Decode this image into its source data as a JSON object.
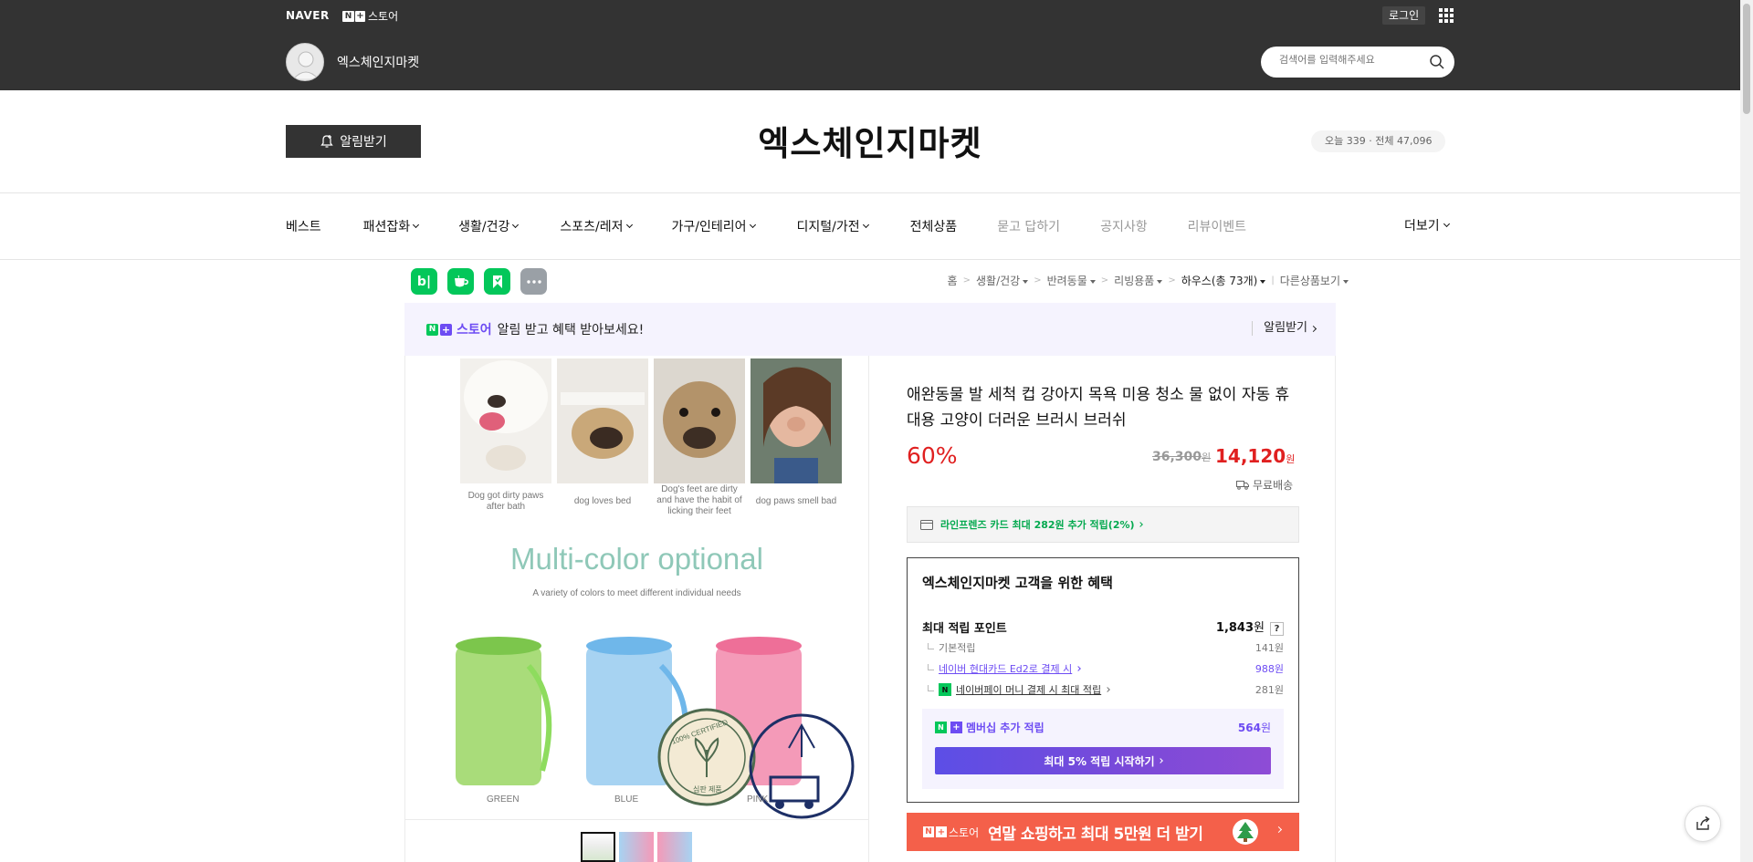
{
  "topbar": {
    "naver_logo": "NAVER",
    "store_brand": "스토어",
    "login_label": "로그인",
    "store_name": "엑스체인지마켓",
    "search_placeholder": "검색어를 입력해주세요"
  },
  "header": {
    "alarm_label": "알림받기",
    "store_title": "엑스체인지마켓",
    "visitors_today": "오늘 339",
    "visitors_total": "전체 47,096"
  },
  "nav": {
    "items": [
      {
        "label": "베스트",
        "dropdown": false
      },
      {
        "label": "패션잡화",
        "dropdown": true
      },
      {
        "label": "생활/건강",
        "dropdown": true
      },
      {
        "label": "스포츠/레저",
        "dropdown": true
      },
      {
        "label": "가구/인테리어",
        "dropdown": true
      },
      {
        "label": "디지털/가전",
        "dropdown": true
      },
      {
        "label": "전체상품",
        "dropdown": false
      },
      {
        "label": "묻고 답하기",
        "dropdown": false
      },
      {
        "label": "공지사항",
        "dropdown": false
      },
      {
        "label": "리뷰이벤트",
        "dropdown": false
      }
    ],
    "more_label": "더보기"
  },
  "share": {
    "icons": [
      "blog-icon",
      "cafe-icon",
      "bookmark-icon",
      "more-icon"
    ],
    "blog_text": "b|"
  },
  "breadcrumb": {
    "home": "홈",
    "level1": "생활/건강",
    "level2": "반려동물",
    "level3": "리빙용품",
    "level4": "하우스(총 73개)",
    "other": "다른상품보기"
  },
  "notice": {
    "brand": "스토어",
    "message": "알림 받고 혜택 받아보세요!",
    "cta": "알림받기"
  },
  "product_image": {
    "labels": [
      "Dog got dirty paws after bath",
      "dog loves bed",
      "Dog's feet are dirty and have the habit of licking their feet",
      "dog paws smell bad"
    ],
    "headline": "Multi-color optional",
    "subline": "A variety of colors to meet different individual needs",
    "cup_colors": [
      "GREEN",
      "BLUE",
      "PINK"
    ],
    "seal_text": "100% CERTIFIED",
    "seal_sub": "심판 제품"
  },
  "product": {
    "title": "애완동물 발 세척 컵 강아지 목욕 미용 청소 물 없이 자동 휴대용 고양이 더러운 브러시 브러쉬",
    "discount": "60%",
    "original_price": "36,300",
    "price": "14,120",
    "won": "원",
    "shipping": "무료배송",
    "card_offer": "라인프렌즈 카드 최대 282원 추가 적립(2%)"
  },
  "benefit": {
    "heading": "엑스체인지마켓 고객을 위한 혜택",
    "max_points_label": "최대 적립 포인트",
    "max_points_value": "1,843",
    "rows": [
      {
        "label": "기본적립",
        "value": "141원"
      },
      {
        "label": "네이버 현대카드 Ed2로 결제 시",
        "value": "988원"
      },
      {
        "label": "네이버페이 머니 결제 시 최대 적립",
        "value": "281원"
      }
    ],
    "membership_label": "멤버십 추가 적립",
    "membership_value": "564",
    "membership_cta": "최대 5% 적립 시작하기"
  },
  "promo": {
    "brand": "스토어",
    "text": "연말 쇼핑하고 최대 5만원 더 받기"
  },
  "colors": {
    "naver_green": "#04c75a",
    "plus_purple": "#6d4cf3",
    "price_red": "#e02020",
    "promo_orange": "#f4604a",
    "dark_bar": "#333333"
  }
}
